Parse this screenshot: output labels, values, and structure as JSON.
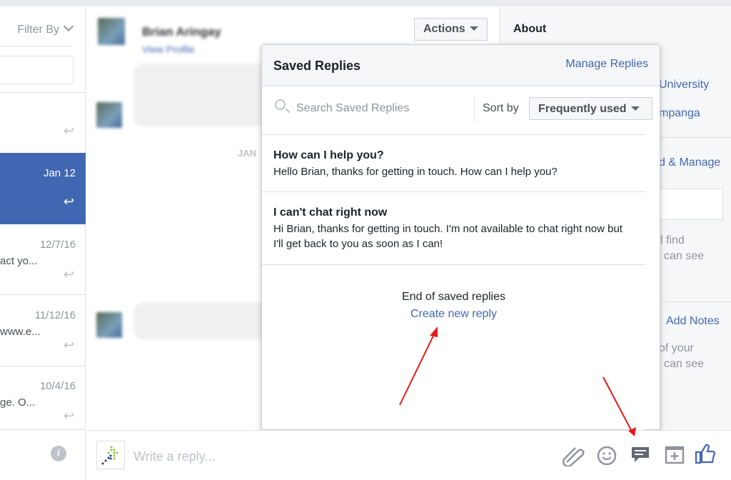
{
  "left_panel": {
    "filter_label": "Filter By",
    "conversations": [
      {
        "date": "",
        "snippet": "",
        "selected": false
      },
      {
        "date": "Jan 12",
        "snippet": "",
        "selected": true
      },
      {
        "date": "12/7/16",
        "snippet": "act yo...",
        "selected": false
      },
      {
        "date": "11/12/16",
        "snippet": "www.e...",
        "selected": false
      },
      {
        "date": "10/4/16",
        "snippet": "ge. O...",
        "selected": false
      }
    ]
  },
  "conversation": {
    "contact_name": "Brian Aringay",
    "view_profile": "View Profile",
    "actions_label": "Actions",
    "date_marker": "JAN",
    "reply_placeholder": "Write a reply..."
  },
  "right_panel": {
    "about_title": "About",
    "lines": [
      "University",
      "mpanga",
      "d & Manage",
      "l find",
      "can see",
      "Add Notes",
      "of your",
      "can see"
    ]
  },
  "saved_replies": {
    "title": "Saved Replies",
    "manage_label": "Manage Replies",
    "search_placeholder": "Search Saved Replies",
    "sort_label": "Sort by",
    "sort_value": "Frequently used",
    "items": [
      {
        "title": "How can I help you?",
        "body": "Hello Brian, thanks for getting in touch. How can I help you?"
      },
      {
        "title": "I can't chat right now",
        "body": "Hi Brian, thanks for getting in touch. I'm not available to chat right now but I'll get back to you as soon as I can!"
      }
    ],
    "end_text": "End of saved replies",
    "create_label": "Create new reply"
  },
  "annotation_color": "#e8191b",
  "accent_color": "#4267b2"
}
